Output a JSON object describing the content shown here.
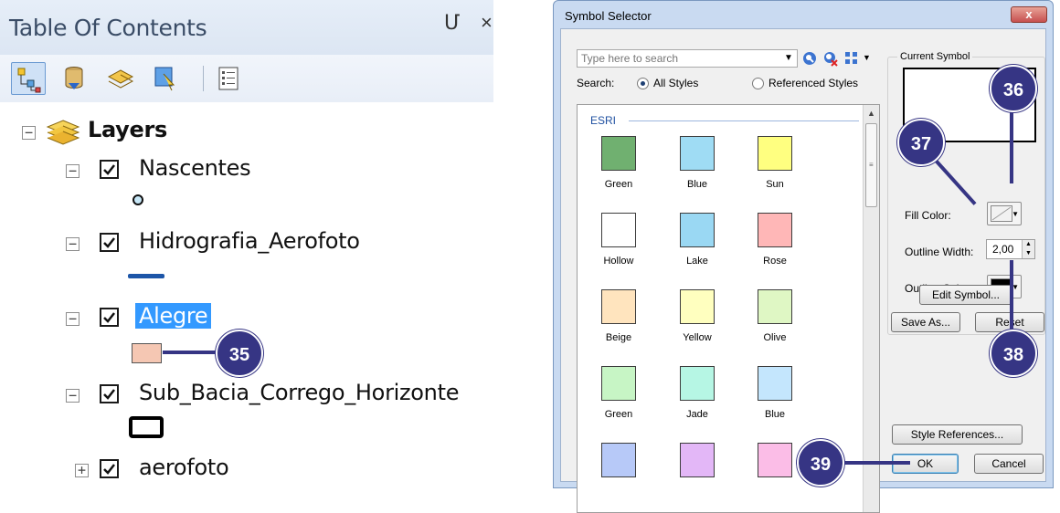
{
  "toc": {
    "title": "Table Of Contents",
    "pin_glyph": "Մ",
    "close_glyph": "×",
    "toolbar": [
      "list-by-drawing-order-icon",
      "list-by-source-icon",
      "list-by-visibility-icon",
      "list-by-selection-icon",
      "options-icon"
    ],
    "root": {
      "expander": "−",
      "label": "Layers",
      "icon": "layers-stack-icon"
    },
    "layers": [
      {
        "name": "Nascentes",
        "checked": true,
        "expander": "−",
        "symbol": "point-circle"
      },
      {
        "name": "Hidrografia_Aerofoto",
        "checked": true,
        "expander": "−",
        "symbol": "blue-line"
      },
      {
        "name": "Alegre",
        "checked": true,
        "expander": "−",
        "symbol": "peach-polygon",
        "selected": true
      },
      {
        "name": "Sub_Bacia_Corrego_Horizonte",
        "checked": true,
        "expander": "−",
        "symbol": "black-outline-polygon"
      },
      {
        "name": "aerofoto",
        "checked": true,
        "expander": "+",
        "symbol": "none"
      }
    ]
  },
  "dialog": {
    "title": "Symbol Selector",
    "close_glyph": "x",
    "search_placeholder": "Type here to search",
    "search_label": "Search:",
    "radio_all": "All Styles",
    "radio_referenced": "Referenced Styles",
    "group_label": "ESRI",
    "swatches": [
      {
        "name": "Green",
        "color": "#70b070"
      },
      {
        "name": "Blue",
        "color": "#9fdcf4"
      },
      {
        "name": "Sun",
        "color": "#ffff80"
      },
      {
        "name": "Hollow",
        "color": "#ffffff"
      },
      {
        "name": "Lake",
        "color": "#9ad8f3"
      },
      {
        "name": "Rose",
        "color": "#ffb7b7"
      },
      {
        "name": "Beige",
        "color": "#ffe4be"
      },
      {
        "name": "Yellow",
        "color": "#ffffbf"
      },
      {
        "name": "Olive",
        "color": "#dff7c4"
      },
      {
        "name": "Green",
        "color": "#c7f5c5"
      },
      {
        "name": "Jade",
        "color": "#b6f6e4"
      },
      {
        "name": "Blue",
        "color": "#c4e6fd"
      },
      {
        "name": "",
        "color": "#b7c9f8"
      },
      {
        "name": "",
        "color": "#e3b7f7"
      },
      {
        "name": "",
        "color": "#fbbde7"
      }
    ],
    "current_symbol_label": "Current Symbol",
    "fill_color_label": "Fill Color:",
    "outline_width_label": "Outline Width:",
    "outline_width_value": "2,00",
    "outline_color_label": "Outline Color:",
    "outline_color": "#000000",
    "edit_symbol": "Edit Symbol...",
    "save_as": "Save As...",
    "reset": "Reset",
    "style_references": "Style References...",
    "ok": "OK",
    "cancel": "Cancel"
  },
  "callouts": {
    "c35": "35",
    "c36": "36",
    "c37": "37",
    "c38": "38",
    "c39": "39"
  },
  "colors": {
    "callout": "#363584",
    "selection": "#3399ff",
    "title_bar": "#c9daf1"
  }
}
